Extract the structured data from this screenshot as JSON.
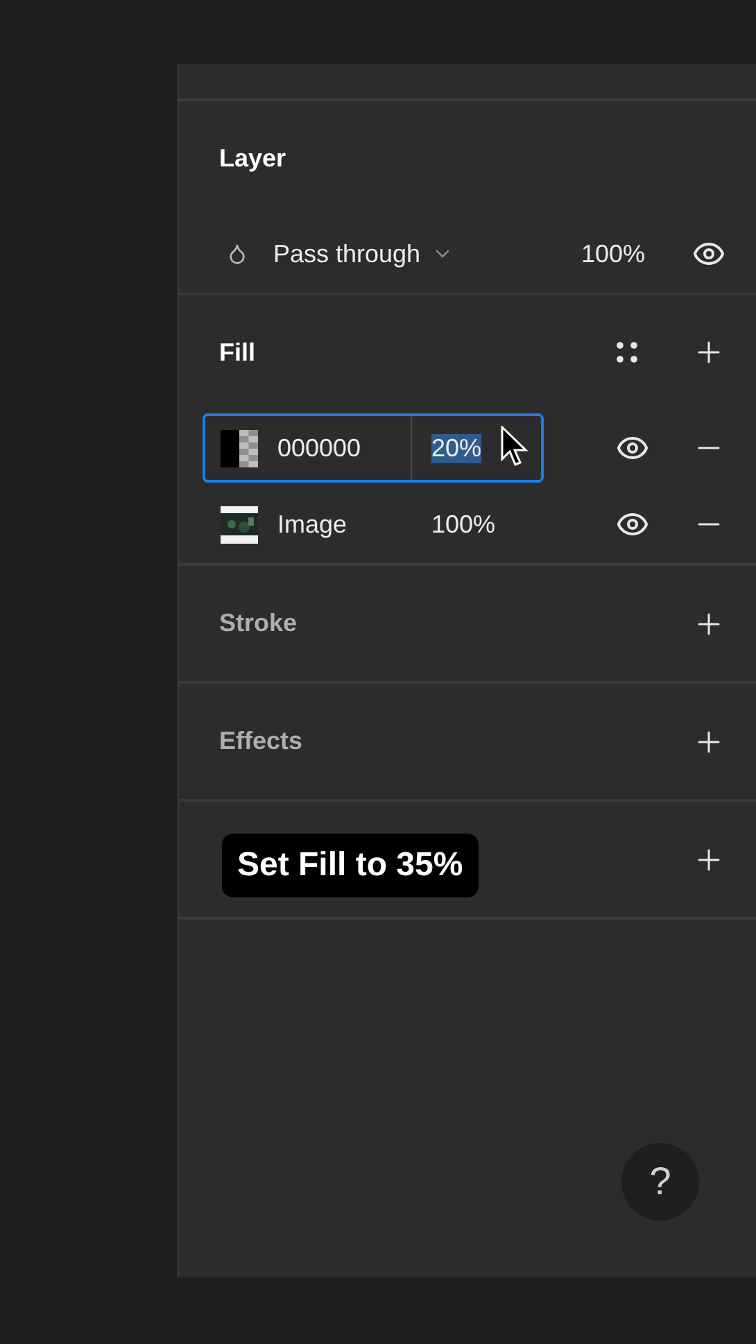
{
  "layer": {
    "title": "Layer",
    "blend_mode": "Pass through",
    "opacity": "100%"
  },
  "fill": {
    "title": "Fill",
    "items": [
      {
        "kind": "color",
        "value": "000000",
        "opacity": "20%",
        "selected": true
      },
      {
        "value": "Image",
        "opacity": "100%",
        "selected": false
      }
    ]
  },
  "sections": [
    {
      "kind": "titled",
      "title": "Stroke"
    },
    {
      "kind": "titled",
      "title": "Effects"
    },
    {
      "kind": "covered"
    }
  ],
  "caption": "Set Fill to 35%",
  "help": "?"
}
